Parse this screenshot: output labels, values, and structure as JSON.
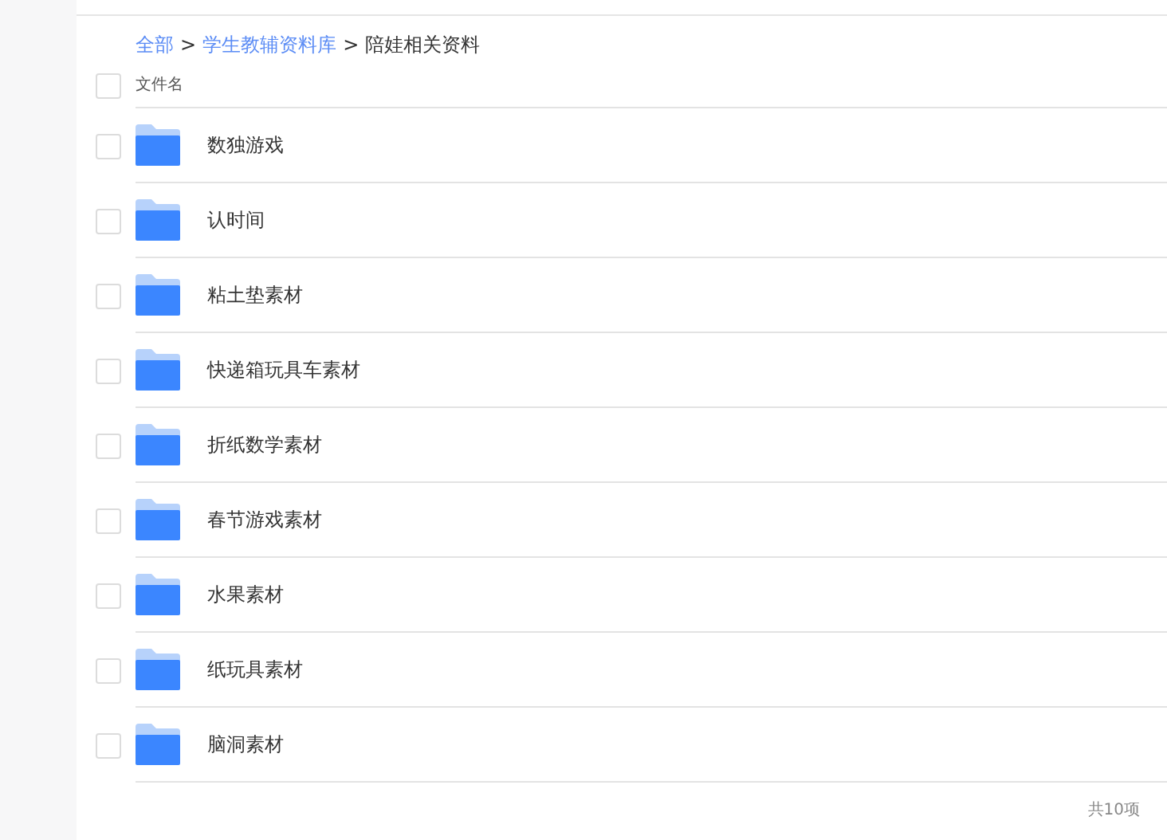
{
  "breadcrumb": [
    {
      "label": "全部",
      "kind": "link"
    },
    {
      "label": "学生教辅资料库",
      "kind": "link"
    },
    {
      "label": "陪娃相关资料",
      "kind": "current"
    }
  ],
  "breadcrumb_separator": ">",
  "header": {
    "label": "文件名",
    "checked": false
  },
  "files": [
    {
      "name": "数独游戏",
      "checked": false
    },
    {
      "name": "认时间",
      "checked": false
    },
    {
      "name": "粘土垫素材",
      "checked": false
    },
    {
      "name": "快递箱玩具车素材",
      "checked": false
    },
    {
      "name": "折纸数学素材",
      "checked": false
    },
    {
      "name": "春节游戏素材",
      "checked": false
    },
    {
      "name": "水果素材",
      "checked": false
    },
    {
      "name": "纸玩具素材",
      "checked": false
    },
    {
      "name": "脑洞素材",
      "checked": false
    }
  ],
  "total": "共10项"
}
